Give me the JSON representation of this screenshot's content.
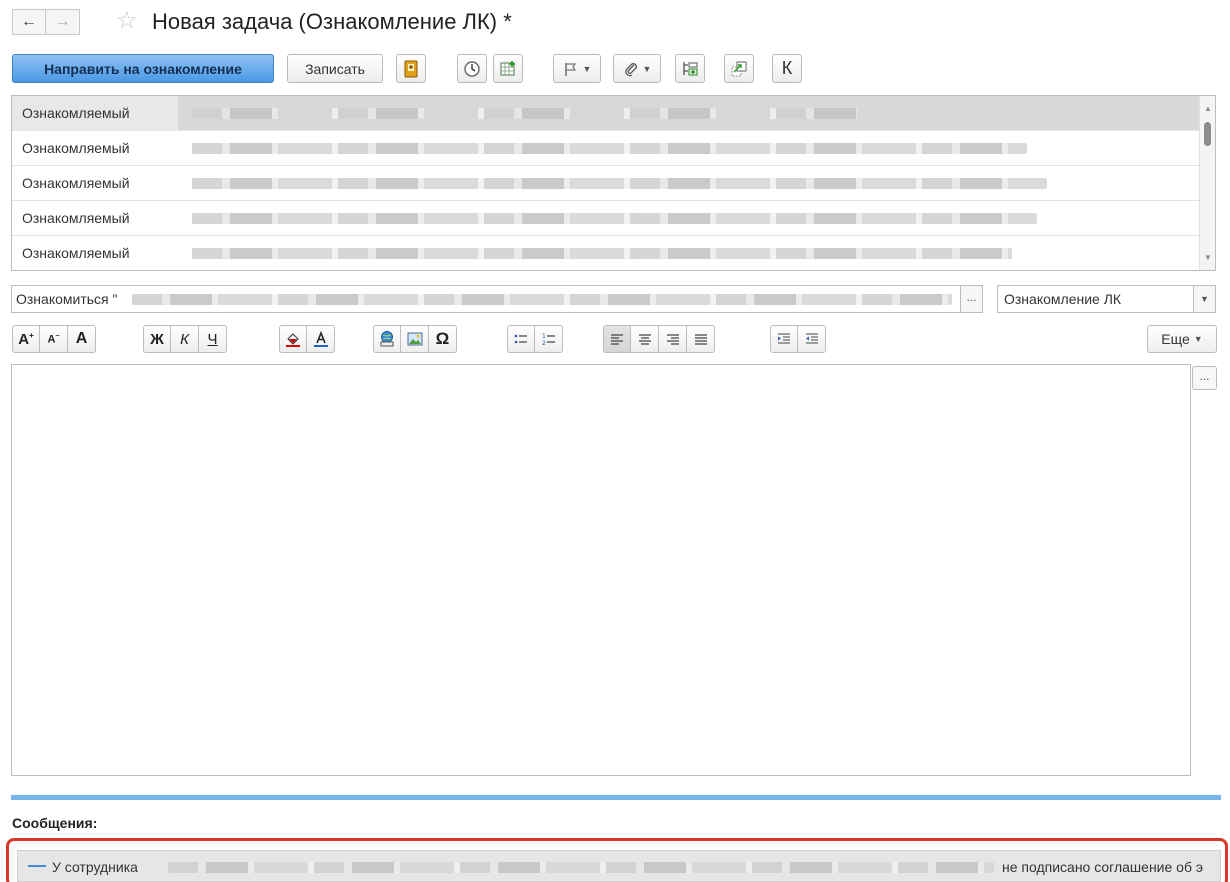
{
  "window": {
    "title": "Новая задача (Ознакомление ЛК) *",
    "back_glyph": "←",
    "forward_glyph": "→",
    "star_glyph": "☆"
  },
  "toolbar": {
    "send_label": "Направить на ознакомление",
    "save_label": "Записать",
    "k_label": "К"
  },
  "members": {
    "rows": [
      {
        "label": "Ознакомляемый",
        "selected": true
      },
      {
        "label": "Ознакомляемый",
        "selected": false
      },
      {
        "label": "Ознакомляемый",
        "selected": false
      },
      {
        "label": "Ознакомляемый",
        "selected": false
      },
      {
        "label": "Ознакомляемый",
        "selected": false
      }
    ]
  },
  "subject": {
    "prefix": "Ознакомиться \"",
    "more": "..."
  },
  "task_type": {
    "value": "Ознакомление ЛК"
  },
  "formatting": {
    "bold_label": "Ж",
    "italic_label": "К",
    "underline_label": "Ч",
    "special_char": "Ω",
    "more_label": "Еще"
  },
  "editor": {
    "more": "..."
  },
  "messages": {
    "title": "Сообщения:",
    "items": [
      {
        "lead": "У сотрудника",
        "tail": "не подписано соглашение об э"
      }
    ]
  },
  "colors": {
    "primary_button": "#4a98e4",
    "splitter": "#76b6ea",
    "highlight_border": "#d9362b"
  }
}
